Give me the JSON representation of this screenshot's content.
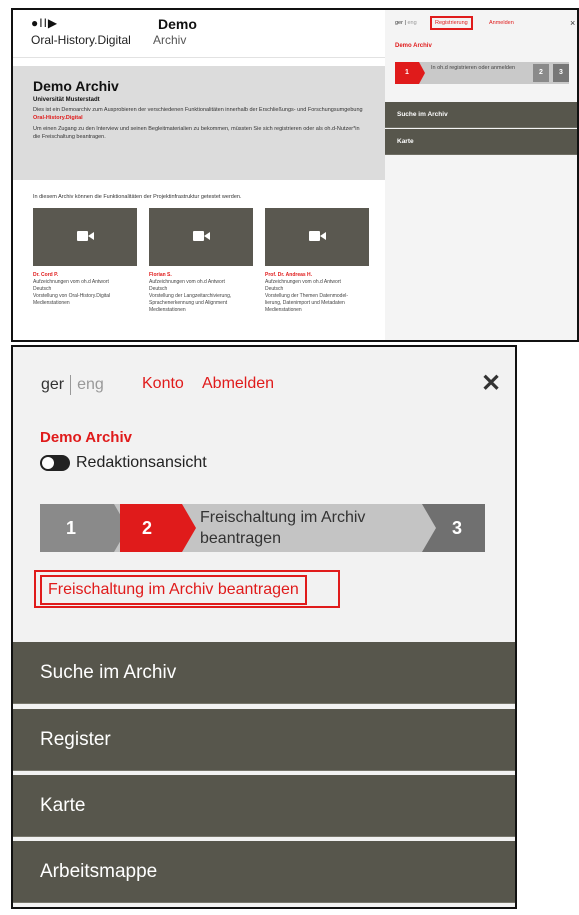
{
  "panel1": {
    "logo_icons": "●II▶",
    "logo_text": "Oral-History.Digital",
    "site_title": "Demo",
    "site_subtitle": "Archiv",
    "intro": {
      "title": "Demo Archiv",
      "institution": "Universität Musterstadt",
      "text1_prefix": "Dies ist ein Demoarchiv zum Ausprobieren der verschiedenen Funktionalitäten innerhalb der Erschließungs- und Forschungsumgebung ",
      "text1_link": "Oral-History.Digital",
      "text2": "Um einen Zugang zu den Interview und seinen Begleitmaterialien zu bekommen, müssten Sie sich registrieren oder als oh.d-Nutzer*in die Freischaltung beantragen."
    },
    "hint": "In diesem Archiv können die Funktionalitäten der Projektinfrastruktur getestet werden.",
    "cards": [
      {
        "name": "Dr. Cord P.",
        "lines": [
          "Aufzeichnungen vom oh.d Antwort",
          "Deutsch",
          "Vorstellung von Oral-History.Digital",
          "Medienstationen"
        ]
      },
      {
        "name": "Florian S.",
        "lines": [
          "Aufzeichnungen vom oh.d Antwort",
          "Deutsch",
          "Vorstellung der Langzeitarchivierung,",
          "Sprachenerkennung und Alignment",
          "Medienstationen"
        ]
      },
      {
        "name": "Prof. Dr. Andreas H.",
        "lines": [
          "Aufzeichnungen vom oh.d Antwort",
          "Deutsch",
          "Vorstellung der Themen Datenmodel-",
          "lierung, Datenimport und Metadaten",
          "Medienstationen"
        ]
      }
    ],
    "sidebar": {
      "lang_ger": "ger",
      "lang_eng": "eng",
      "register": "Registrierung",
      "login": "Anmelden",
      "close": "×",
      "archive": "Demo Archiv",
      "steps": {
        "one": "1",
        "label": "In oh.d registrieren oder anmelden",
        "two": "2",
        "three": "3"
      },
      "nav": [
        "Suche im Archiv",
        "Karte"
      ]
    }
  },
  "panel2": {
    "lang_ger": "ger",
    "lang_eng": "eng",
    "konto": "Konto",
    "logout": "Abmelden",
    "close": "✕",
    "archive": "Demo Archiv",
    "toggle_label": "Redaktionsansicht",
    "steps": {
      "one": "1",
      "two": "2",
      "label": "Freischaltung im Archiv beantragen",
      "three": "3"
    },
    "request_button": "Freischaltung im Archiv beantragen",
    "nav": [
      "Suche im Archiv",
      "Register",
      "Karte",
      "Arbeitsmappe"
    ]
  },
  "colors": {
    "accent": "#e01b1b",
    "nav_bg": "#57564c",
    "intro_bg": "#dcdcdc"
  }
}
